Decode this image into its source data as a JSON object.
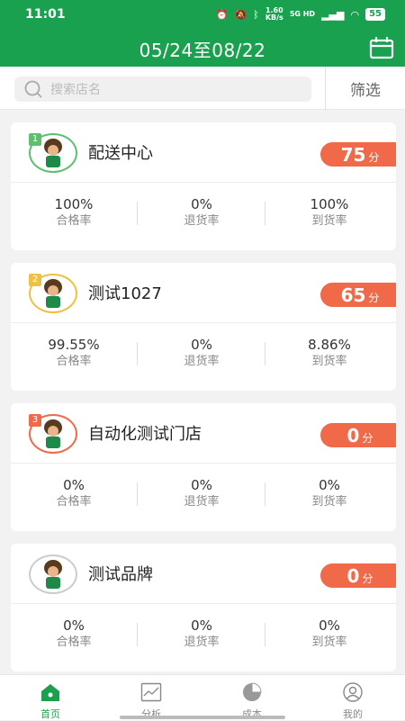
{
  "status_bar": {
    "time": "11:01",
    "speed_value": "1.60",
    "speed_unit": "KB/s",
    "network": "5G HD",
    "battery": "55"
  },
  "header": {
    "title": "05/24至08/22"
  },
  "search": {
    "placeholder": "搜索店名",
    "filter_label": "筛选"
  },
  "colors": {
    "brand": "#1aa150",
    "score_bg": "#f06a4a",
    "rank1": "#5cc06e",
    "rank2": "#f0c040",
    "rank3": "#f06a4a"
  },
  "stores": [
    {
      "rank": "1",
      "name": "配送中心",
      "score": "75",
      "score_unit": "分",
      "pass_rate": "100%",
      "pass_label": "合格率",
      "return_rate": "0%",
      "return_label": "退货率",
      "arrival_rate": "100%",
      "arrival_label": "到货率"
    },
    {
      "rank": "2",
      "name": "测试1027",
      "score": "65",
      "score_unit": "分",
      "pass_rate": "99.55%",
      "pass_label": "合格率",
      "return_rate": "0%",
      "return_label": "退货率",
      "arrival_rate": "8.86%",
      "arrival_label": "到货率"
    },
    {
      "rank": "3",
      "name": "自动化测试门店",
      "score": "0",
      "score_unit": "分",
      "pass_rate": "0%",
      "pass_label": "合格率",
      "return_rate": "0%",
      "return_label": "退货率",
      "arrival_rate": "0%",
      "arrival_label": "到货率"
    },
    {
      "rank": "",
      "name": "测试品牌",
      "score": "0",
      "score_unit": "分",
      "pass_rate": "0%",
      "pass_label": "合格率",
      "return_rate": "0%",
      "return_label": "退货率",
      "arrival_rate": "0%",
      "arrival_label": "到货率"
    }
  ],
  "tabs": [
    {
      "label": "首页",
      "icon": "home-icon",
      "active": true
    },
    {
      "label": "分析",
      "icon": "chart-icon",
      "active": false
    },
    {
      "label": "成本",
      "icon": "pie-icon",
      "active": false
    },
    {
      "label": "我的",
      "icon": "user-icon",
      "active": false
    }
  ]
}
